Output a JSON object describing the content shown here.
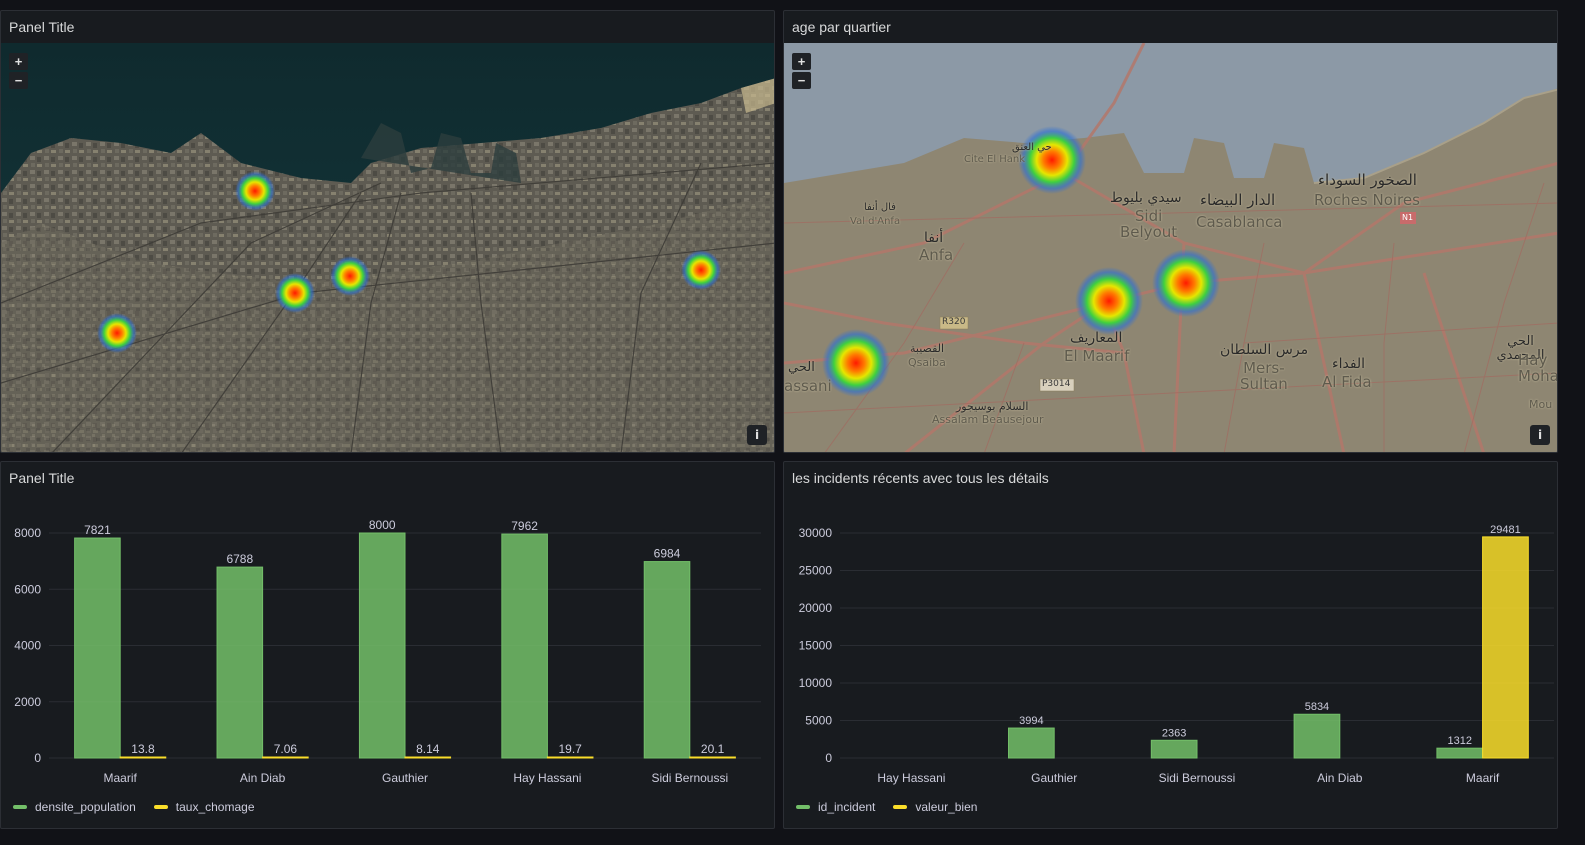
{
  "panels": {
    "satellite_map": {
      "title": "Panel Title"
    },
    "street_map": {
      "title": "age par quartier",
      "labels": {
        "cite_el_hank_ar": "حي العنق",
        "cite_el_hank": "Cite El Hank",
        "val_dafa_ar": "فال أنفا",
        "val_dafa": "Val d'Anfa",
        "anfa_ar": "أنفا",
        "anfa": "Anfa",
        "sidi_belyout_ar": "سيدي بليوط",
        "sidi_belyout": "Sidi\nBelyout",
        "casablanca_ar": "الدار البيضاء",
        "casablanca": "Casablanca",
        "roches_noires_ar": "الصخور السوداء",
        "roches_noires": "Roches Noires",
        "maarif_ar": "المعاريف",
        "maarif": "El Maarif",
        "mers_sultan_ar": "مرس السلطان",
        "mers_sultan": "Mers-\nSultan",
        "al_fida_ar": "الفداء",
        "al_fida": "Al Fida",
        "qsaiba_ar": "القصيبة",
        "qsaiba": "Qsaiba",
        "assalam_ar": "السلام بوسيجور",
        "assalam": "Assalam Beausejour",
        "hay_mohammadi_ar": "الحي المحمدي",
        "hay_mohammadi": "Hay\nMohamm",
        "hassani_ar": "الحي",
        "hassani": "assani",
        "r320": "R320",
        "p3014": "P3014",
        "n1": "N1",
        "mou": "Mou"
      }
    },
    "bar_left": {
      "title": "Panel Title",
      "legend": [
        {
          "name": "densite_population",
          "color": "#73bf69"
        },
        {
          "name": "taux_chomage",
          "color": "#fade2a"
        }
      ]
    },
    "bar_right": {
      "title": "les incidents récents avec tous les détails",
      "legend": [
        {
          "name": "id_incident",
          "color": "#73bf69"
        },
        {
          "name": "valeur_bien",
          "color": "#fade2a"
        }
      ]
    }
  },
  "map_controls": {
    "zoom_in": "+",
    "zoom_out": "−",
    "info": "i"
  },
  "chart_data": [
    {
      "type": "bar",
      "categories": [
        "Maarif",
        "Ain Diab",
        "Gauthier",
        "Hay Hassani",
        "Sidi Bernoussi"
      ],
      "series": [
        {
          "name": "densite_population",
          "values": [
            7821,
            6788,
            8000,
            7962,
            6984
          ],
          "labels": [
            "7821",
            "6788",
            "8000",
            "7962",
            "6984"
          ],
          "color": "#73bf69"
        },
        {
          "name": "taux_chomage",
          "values": [
            13.8,
            7.06,
            8.14,
            19.7,
            20.1
          ],
          "labels": [
            "13.8",
            "7.06",
            "8.14",
            "19.7",
            "20.1"
          ],
          "color": "#fade2a"
        }
      ],
      "yticks": [
        "0",
        "2000",
        "4000",
        "6000",
        "8000"
      ],
      "ylim": [
        0,
        8000
      ],
      "grid": true,
      "legend": "bottom-left"
    },
    {
      "type": "bar",
      "categories": [
        "Hay Hassani",
        "Gauthier",
        "Sidi Bernoussi",
        "Ain Diab",
        "Maarif"
      ],
      "series": [
        {
          "name": "id_incident",
          "values": [
            null,
            3994,
            2363,
            5834,
            1312
          ],
          "labels": [
            "",
            "3994",
            "2363",
            "5834",
            "1312"
          ],
          "color": "#73bf69"
        },
        {
          "name": "valeur_bien",
          "values": [
            null,
            null,
            null,
            null,
            29481
          ],
          "labels": [
            "",
            "",
            "",
            "",
            "29481"
          ],
          "color": "#fade2a"
        }
      ],
      "yticks": [
        "0",
        "5000",
        "10000",
        "15000",
        "20000",
        "25000",
        "30000"
      ],
      "ylim": [
        0,
        30000
      ],
      "grid": true,
      "legend": "bottom-left"
    }
  ]
}
